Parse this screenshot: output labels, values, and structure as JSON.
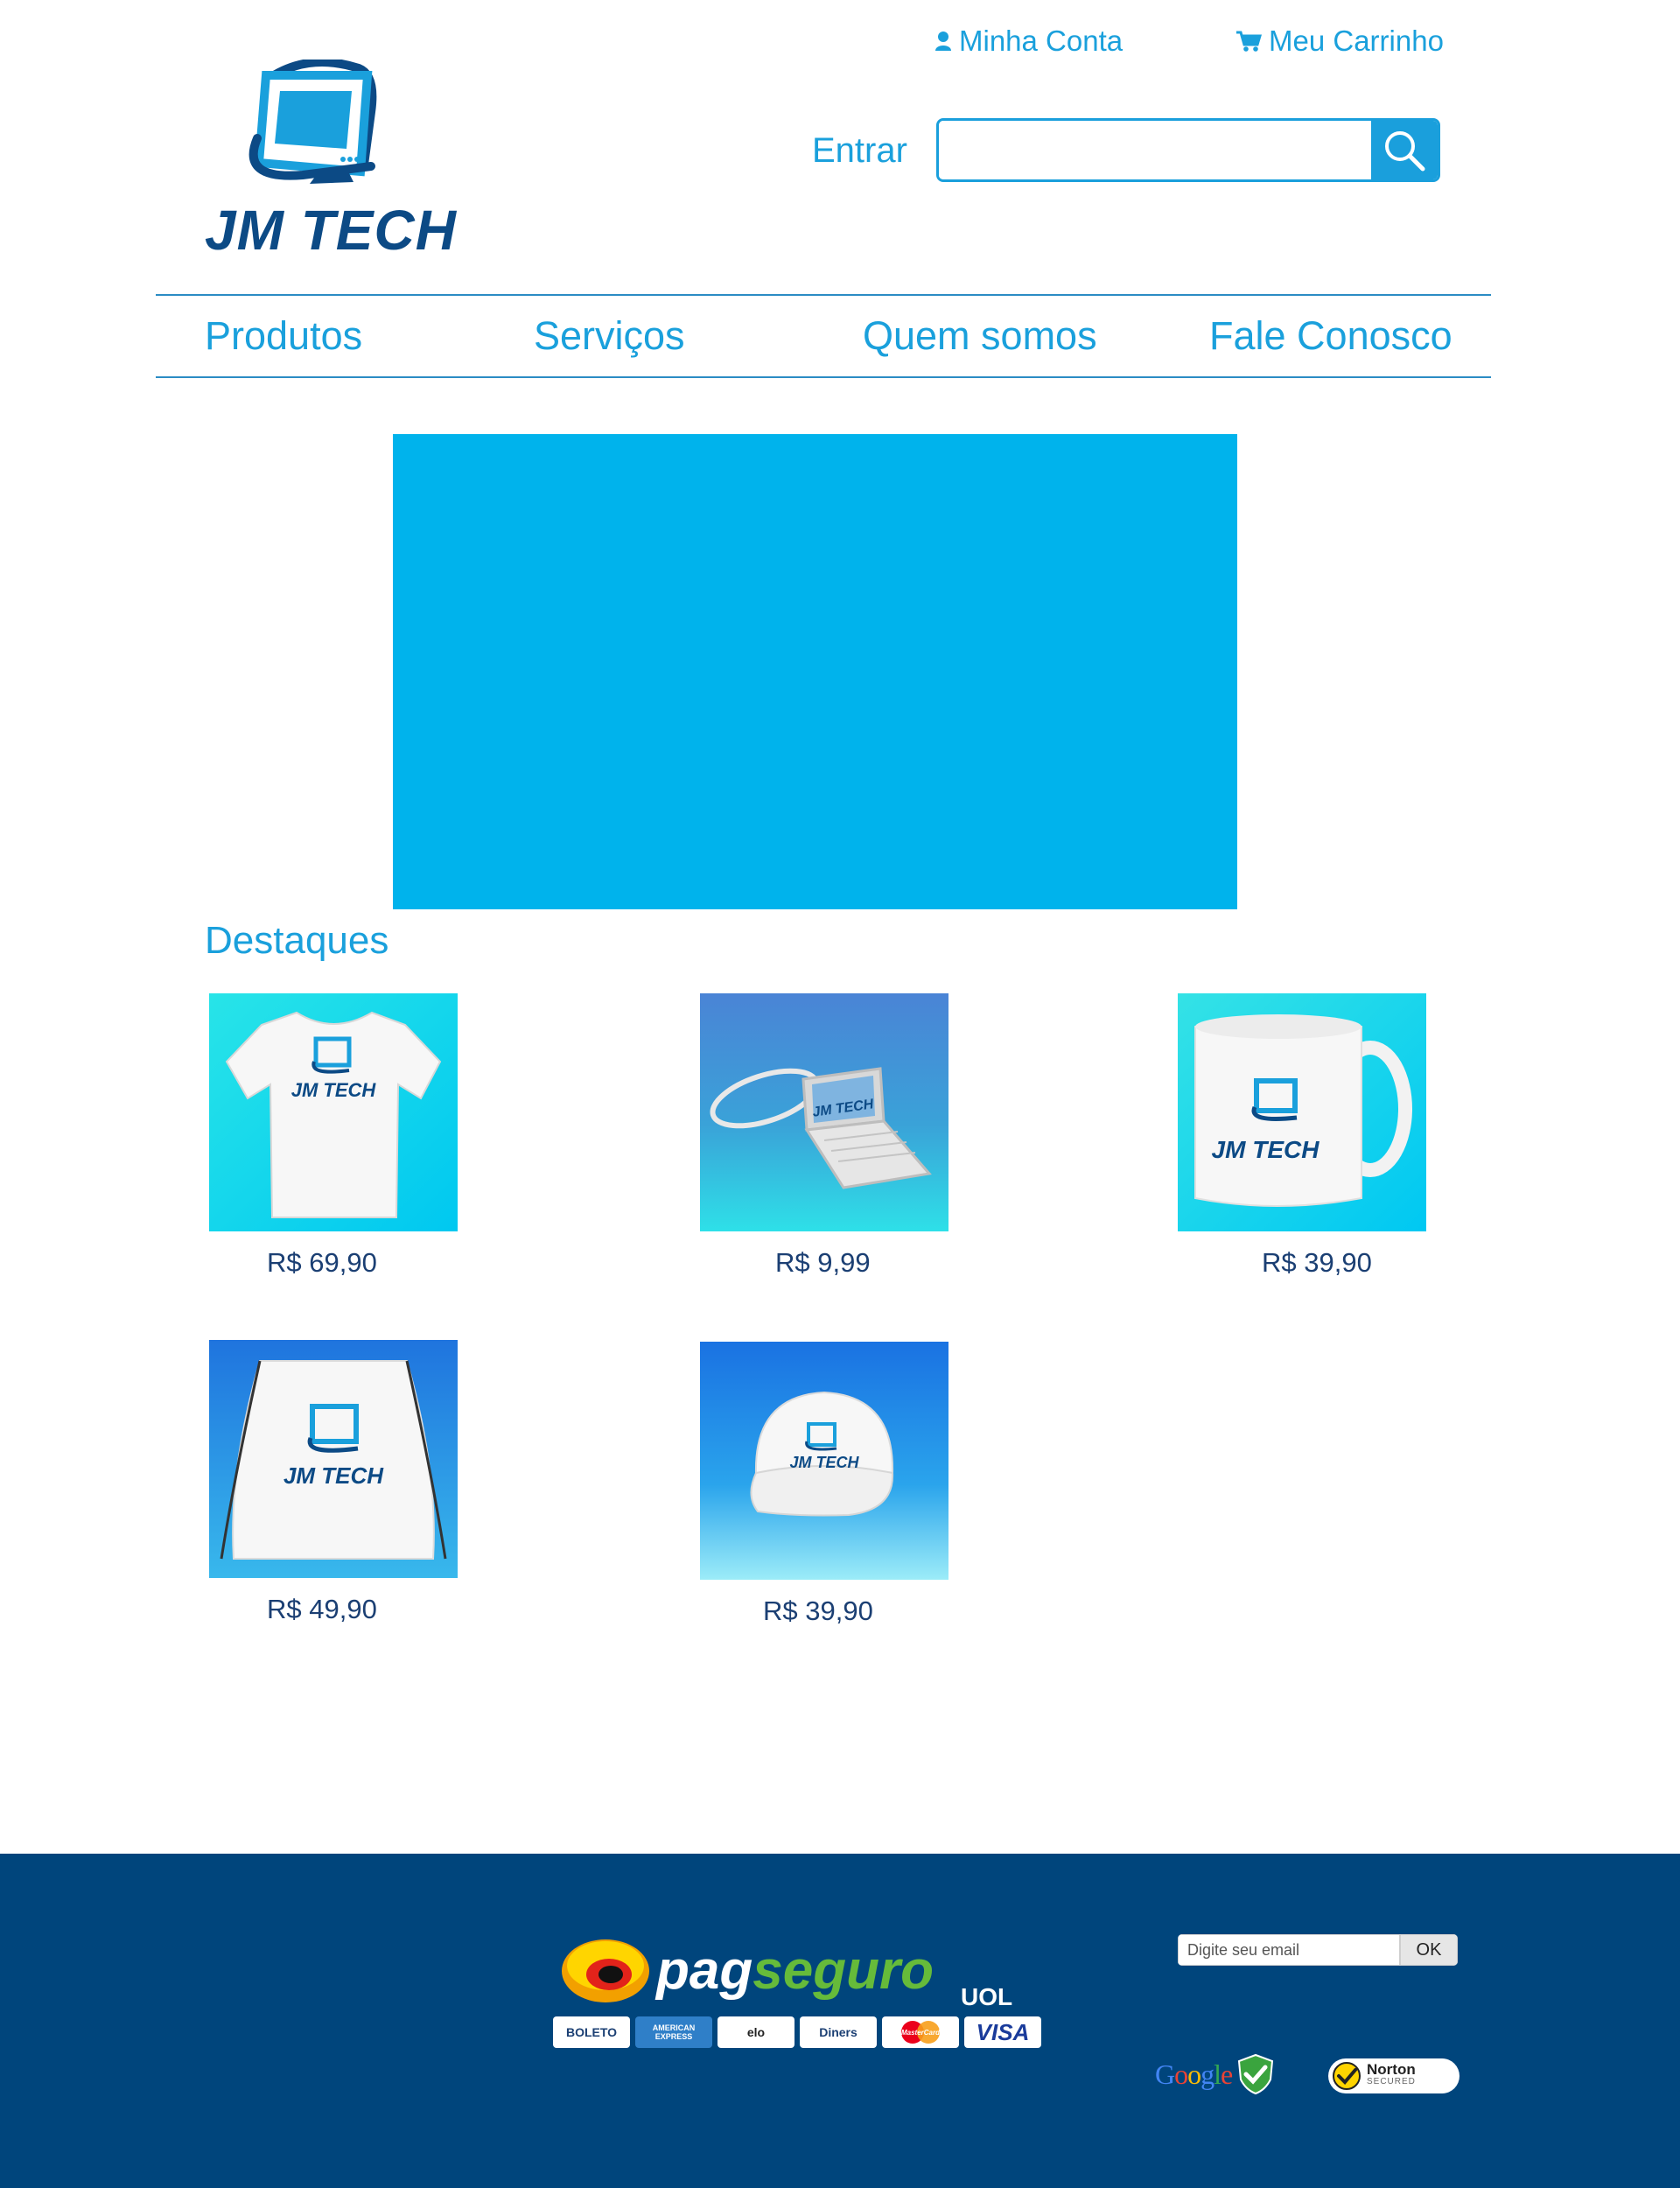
{
  "header": {
    "account_label": "Minha Conta",
    "cart_label": "Meu Carrinho",
    "login_label": "Entrar",
    "search": {
      "value": "",
      "placeholder": ""
    },
    "logo_text": "JM TECH"
  },
  "nav": {
    "items": [
      {
        "label": "Produtos"
      },
      {
        "label": "Serviços"
      },
      {
        "label": "Quem somos"
      },
      {
        "label": "Fale Conosco"
      }
    ]
  },
  "featured": {
    "title": "Destaques",
    "products": [
      {
        "image": "jm-tech-tshirt",
        "logo_text": "JM TECH",
        "price": "R$ 69,90"
      },
      {
        "image": "jm-tech-laptop-keychain",
        "logo_text": "JM TECH",
        "price": "R$ 9,99"
      },
      {
        "image": "jm-tech-mug",
        "logo_text": "JM TECH",
        "price": "R$ 39,90"
      },
      {
        "image": "jm-tech-drawstring-bag",
        "logo_text": "JM TECH",
        "price": "R$ 49,90"
      },
      {
        "image": "jm-tech-cap",
        "logo_text": "JM TECH",
        "price": "R$ 39,90"
      }
    ]
  },
  "footer": {
    "pagseguro": {
      "brand_1": "pag",
      "brand_2": "seguro",
      "brand_3": "UOL"
    },
    "payment_methods": [
      "BOLETO",
      "AMERICAN EXPRESS",
      "elo",
      "Diners",
      "MasterCard",
      "VISA"
    ],
    "newsletter": {
      "placeholder": "Digite seu email",
      "button_label": "OK"
    },
    "security_badges": {
      "google": "Google",
      "norton_title": "Norton",
      "norton_subtitle": "SECURED"
    }
  },
  "colors": {
    "accent": "#1aa0dc",
    "banner": "#00b3ec",
    "footer": "#00457c",
    "logo_dark": "#0c4a85",
    "price": "#1b3f73"
  }
}
